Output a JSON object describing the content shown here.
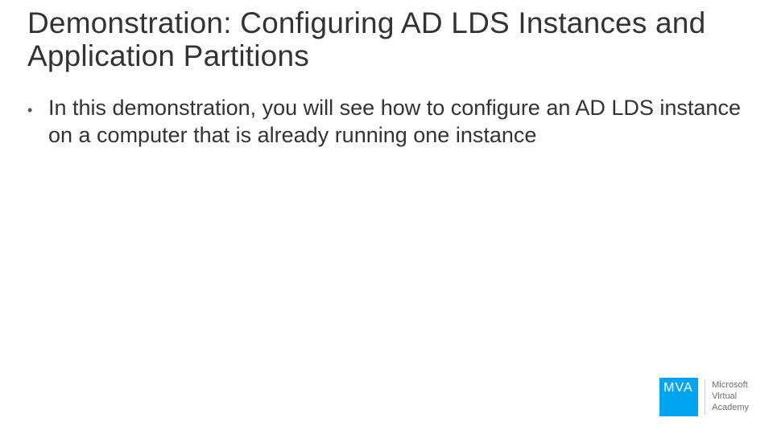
{
  "title": "Demonstration: Configuring AD LDS Instances and Application Partitions",
  "bullets": [
    "In this demonstration, you will see how to configure an AD LDS instance on a computer that is already running one instance"
  ],
  "logo": {
    "badge": "MVA",
    "line1": "Microsoft",
    "line2": "Virtual",
    "line3": "Academy"
  },
  "colors": {
    "accent": "#00a4ef"
  }
}
